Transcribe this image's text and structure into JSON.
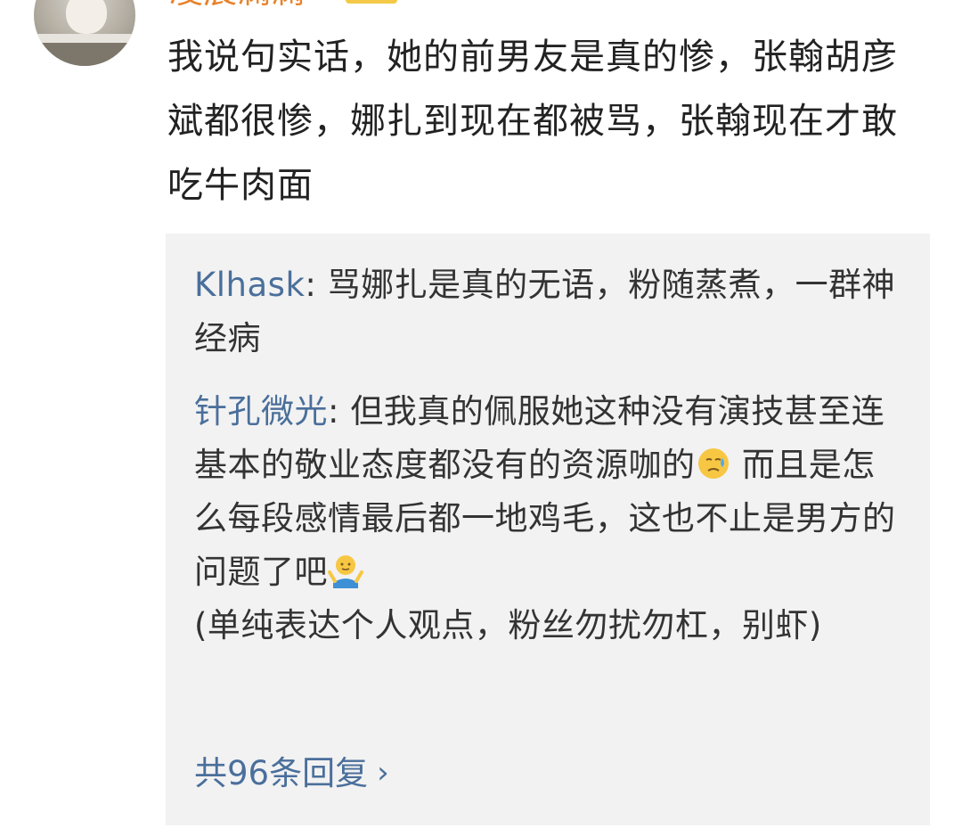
{
  "comment": {
    "username": "凌晨澜澜",
    "text": "我说句实话，她的前男友是真的惨，张翰胡彦斌都很惨，娜扎到现在都被骂，张翰现在才敢吃牛肉面"
  },
  "replies": [
    {
      "user": "Klhask",
      "text": ": 骂娜扎是真的无语，粉随蒸煮，一群神经病"
    },
    {
      "user": "针孔微光",
      "text_part1": ": 但我真的佩服她这种没有演技甚至连基本的敬业态度都没有的资源咖的",
      "emoji1": "sweat-face-icon",
      "text_part2": " 而且是怎么每段感情最后都一地鸡毛，这也不止是男方的问题了吧",
      "emoji2": "shrug-icon",
      "text_part3": "(单纯表达个人观点，粉丝勿扰勿杠，别虾)"
    }
  ],
  "more_replies": {
    "label": "共96条回复",
    "chevron": "›"
  }
}
